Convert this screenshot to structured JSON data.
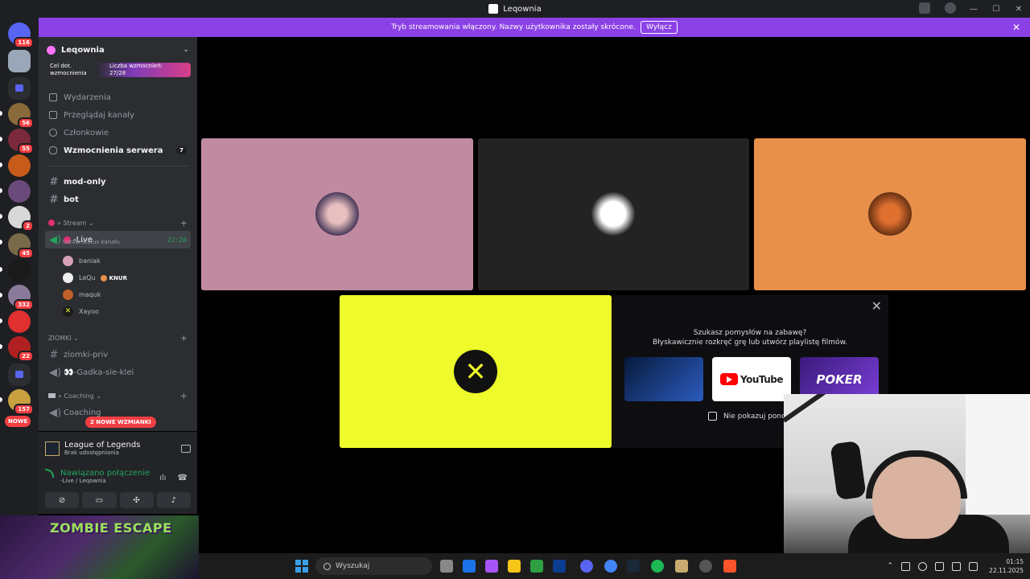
{
  "window": {
    "title": "Leqownia"
  },
  "banner": {
    "text": "Tryb streamowania włączony. Nazwy użytkownika zostały skrócone.",
    "button": "Wyłącz"
  },
  "guilds": [
    {
      "badge": "116"
    },
    {
      "badge": ""
    },
    {
      "badge": ""
    },
    {
      "badge": "56"
    },
    {
      "badge": "55"
    },
    {
      "badge": ""
    },
    {
      "badge": ""
    },
    {
      "badge": "2"
    },
    {
      "badge": "45"
    },
    {
      "badge": ""
    },
    {
      "badge": "332"
    },
    {
      "badge": ""
    },
    {
      "badge": "22"
    },
    {
      "badge": ""
    },
    {
      "badge": "157"
    }
  ],
  "guild_pill": "NOWE",
  "server": {
    "name": "Leqownia",
    "boost_goal": "Cel dot. wzmocnienia",
    "boost_count": "Liczba wzmocnień: 27/28",
    "nav": [
      {
        "label": "Wydarzenia"
      },
      {
        "label": "Przeglądaj kanały"
      },
      {
        "label": "Członkowie"
      },
      {
        "label": "Wzmocnienia serwera",
        "count": "7"
      }
    ],
    "channels_top": [
      "mod-only",
      "bot"
    ],
    "cat_stream": "» Stream",
    "live_channel": {
      "name": "-Live",
      "time": "22:20",
      "status": "Ustaw status kanału"
    },
    "voice_users": [
      {
        "name": "baniak",
        "tag": ""
      },
      {
        "name": "LeQu",
        "tag": "KNUR"
      },
      {
        "name": "maquk",
        "tag": ""
      },
      {
        "name": "Xayoo",
        "tag": ""
      }
    ],
    "cat_ziomki": "ZIOMKI",
    "ziomki_channels": [
      "ziomki-priv",
      "👀-Gadka-sie-klei"
    ],
    "cat_coaching": "» Coaching",
    "coaching_channel": "Coaching",
    "mentions_pill": "2 NOWE WZMIANKI"
  },
  "activity": {
    "game": "League of Legends",
    "sub": "Brak udostępniania"
  },
  "voice_panel": {
    "status": "Nawiązano połączenie",
    "channel": "-Live / Leqownia"
  },
  "promo": {
    "title": "ZOMBIE ESCAPE"
  },
  "popup": {
    "question": "Szukasz pomysłów na zabawę?",
    "hint": "Błyskawicznie rozkręć grę lub utwórz playlistę filmów.",
    "card_youtube": "YouTube",
    "card_poker": "POKER",
    "checkbox": "Nie pokazuj ponow"
  },
  "colors": {
    "tile1": "#c08aa0",
    "tile2": "#232323",
    "tile3": "#e8904a",
    "tile4": "#eefa2a",
    "accent": "#8b41e6"
  },
  "taskbar": {
    "search": "Wyszukaj",
    "time": "01:15",
    "date": "22.11.2025"
  }
}
